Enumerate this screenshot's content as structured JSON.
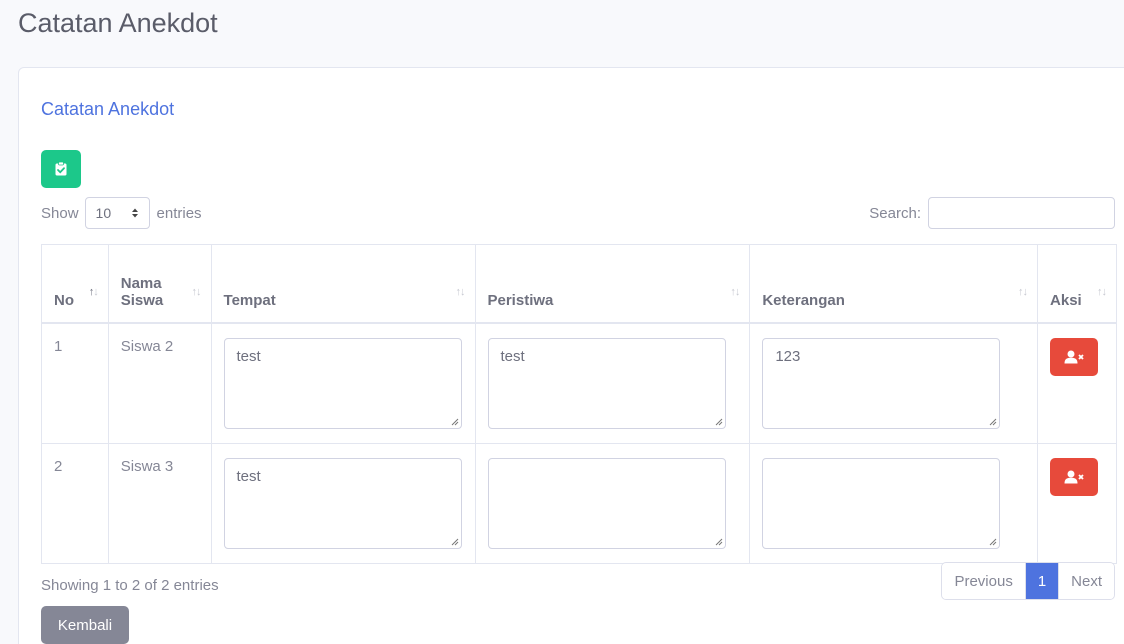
{
  "page": {
    "title": "Catatan Anekdot"
  },
  "card": {
    "title": "Catatan Anekdot",
    "add_icon": "clipboard-check-icon"
  },
  "length": {
    "show_label": "Show",
    "value": "10",
    "entries_label": "entries"
  },
  "search": {
    "label": "Search:",
    "value": ""
  },
  "table": {
    "headers": [
      "No",
      "Nama Siswa",
      "Tempat",
      "Peristiwa",
      "Keterangan",
      "Aksi"
    ],
    "rows": [
      {
        "no": "1",
        "nama": "Siswa 2",
        "tempat": "test",
        "peristiwa": "test",
        "keterangan": "123",
        "action_icon": "user-times-icon"
      },
      {
        "no": "2",
        "nama": "Siswa 3",
        "tempat": "test",
        "peristiwa": "",
        "keterangan": "",
        "action_icon": "user-times-icon"
      }
    ]
  },
  "info": "Showing 1 to 2 of 2 entries",
  "pagination": {
    "previous": "Previous",
    "current": "1",
    "next": "Next"
  },
  "back_button": "Kembali",
  "colors": {
    "primary": "#4e73df",
    "success": "#1cc88a",
    "danger": "#e74a3b",
    "secondary": "#858796"
  }
}
